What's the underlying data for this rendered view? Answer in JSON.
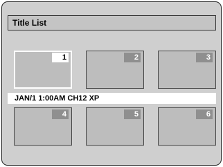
{
  "title_bar": {
    "label": "Title List"
  },
  "titles": [
    {
      "number": "1",
      "selected": true
    },
    {
      "number": "2",
      "selected": false
    },
    {
      "number": "3",
      "selected": false
    },
    {
      "number": "4",
      "selected": false
    },
    {
      "number": "5",
      "selected": false
    },
    {
      "number": "6",
      "selected": false
    }
  ],
  "info": {
    "text": "JAN/1 1:00AM CH12 XP"
  },
  "colors": {
    "screen_bg": "#cfcfcf",
    "thumbnail_bg": "#bdbdbd",
    "number_badge": "#8f8f8f",
    "selection": "#ffffff"
  }
}
